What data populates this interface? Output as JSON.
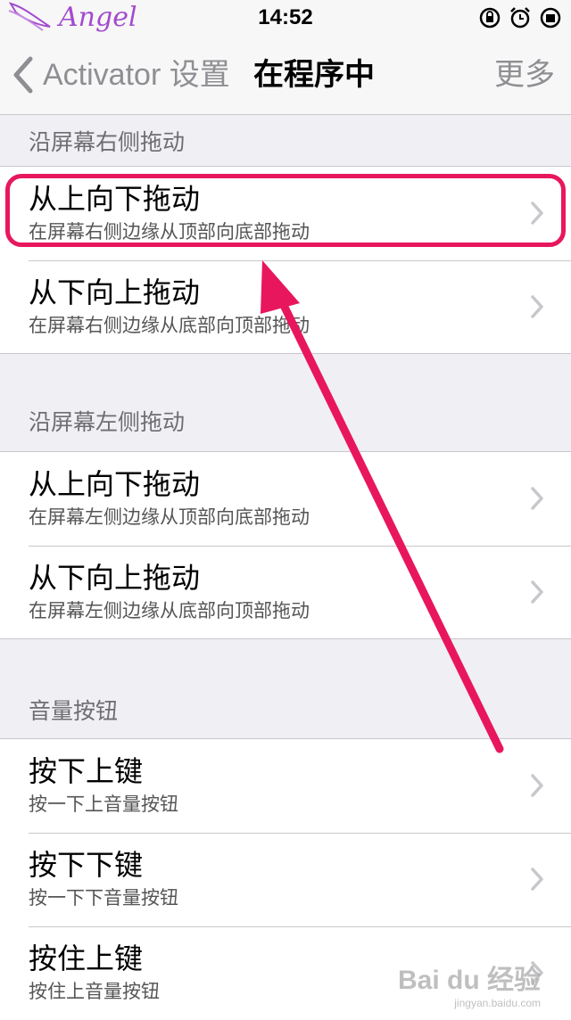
{
  "status_bar": {
    "carrier": "Angel",
    "time": "14:52",
    "icons": [
      "rotation-lock-icon",
      "alarm-icon",
      "battery-icon"
    ]
  },
  "nav": {
    "back_label": "Activator 设置",
    "title": "在程序中",
    "more_label": "更多"
  },
  "sections": [
    {
      "header": "沿屏幕右侧拖动",
      "rows": [
        {
          "title": "从上向下拖动",
          "subtitle": "在屏幕右侧边缘从顶部向底部拖动"
        },
        {
          "title": "从下向上拖动",
          "subtitle": "在屏幕右侧边缘从底部向顶部拖动"
        }
      ]
    },
    {
      "header": "沿屏幕左侧拖动",
      "rows": [
        {
          "title": "从上向下拖动",
          "subtitle": "在屏幕左侧边缘从顶部向底部拖动"
        },
        {
          "title": "从下向上拖动",
          "subtitle": "在屏幕左侧边缘从底部向顶部拖动"
        }
      ]
    },
    {
      "header": "音量按钮",
      "rows": [
        {
          "title": "按下上键",
          "subtitle": "按一下上音量按钮"
        },
        {
          "title": "按下下键",
          "subtitle": "按一下下音量按钮"
        },
        {
          "title": "按住上键",
          "subtitle": "按住上音量按钮"
        }
      ]
    }
  ],
  "annotation": {
    "color": "#e8175d"
  },
  "watermark": {
    "main": "Bai du 经验",
    "sub": "jingyan.baidu.com"
  }
}
